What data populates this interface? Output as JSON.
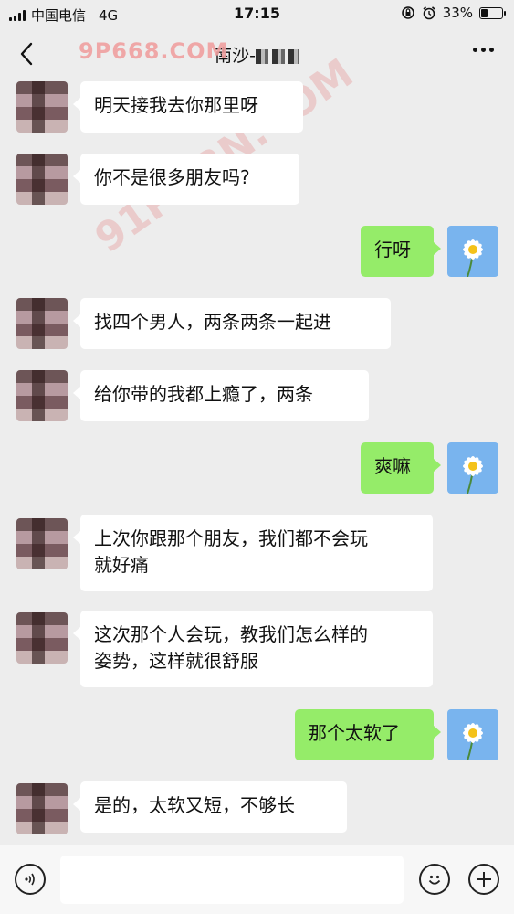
{
  "status_bar": {
    "carrier": "中国电信",
    "network": "4G",
    "time": "17:15",
    "battery_percent": "33%",
    "battery_level": 0.33
  },
  "nav": {
    "title": "南沙-",
    "back_icon": "chevron-left-icon",
    "more_icon": "more-dots-icon"
  },
  "watermarks": {
    "top": "9P668.COM",
    "diagonal": "91PORN.COM"
  },
  "messages": [
    {
      "side": "in",
      "text": "明天接我去你那里呀"
    },
    {
      "side": "in",
      "text": "你不是很多朋友吗?"
    },
    {
      "side": "out",
      "text": "行呀"
    },
    {
      "side": "in",
      "text": "找四个男人，两条两条一起进"
    },
    {
      "side": "in",
      "text": "给你带的我都上瘾了，两条"
    },
    {
      "side": "out",
      "text": "爽嘛"
    },
    {
      "side": "in",
      "text": "上次你跟那个朋友，我们都不会玩\n就好痛"
    },
    {
      "side": "in",
      "text": "这次那个人会玩，教我们怎么样的\n姿势，这样就很舒服"
    },
    {
      "side": "out",
      "text": "那个太软了"
    },
    {
      "side": "in",
      "text": "是的，太软又短，不够长"
    }
  ],
  "input_bar": {
    "value": "",
    "voice_icon": "voice-icon",
    "emoji_icon": "emoji-icon",
    "plus_icon": "plus-icon"
  },
  "colors": {
    "background": "#ededed",
    "incoming_bubble": "#ffffff",
    "outgoing_bubble": "#95ec69",
    "watermark": "#f0a0a0"
  }
}
